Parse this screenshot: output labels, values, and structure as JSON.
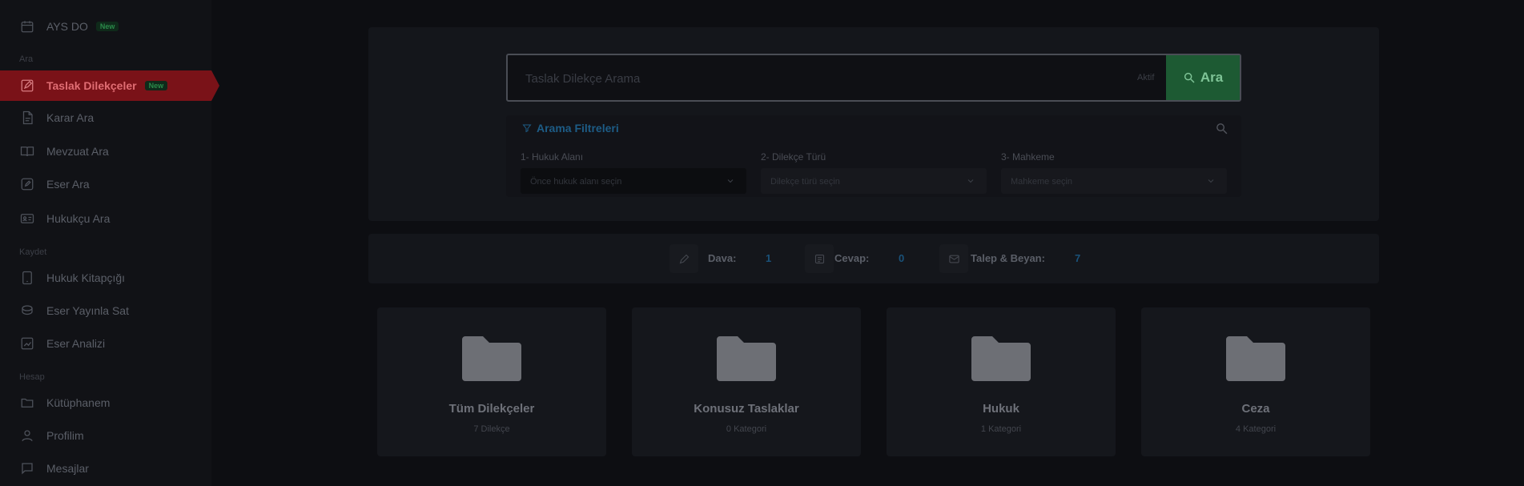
{
  "sidebar": {
    "top_item": {
      "label": "AYS DO",
      "badge": "New",
      "icon": "calendar-icon"
    },
    "sections": [
      "Ara",
      "Kaydet",
      "Hesap"
    ],
    "items": [
      {
        "label": "Taslak Dilekçeler",
        "badge": "New",
        "icon": "edit-icon",
        "active": true
      },
      {
        "label": "Karar Ara",
        "icon": "document-icon"
      },
      {
        "label": "Mevzuat Ara",
        "icon": "book-open-icon"
      },
      {
        "label": "Eser Ara",
        "icon": "edit-square-icon"
      },
      {
        "label": "Hukukçu Ara",
        "icon": "id-card-icon"
      },
      {
        "label": "Hukuk Kitapçığı",
        "icon": "tablet-icon"
      },
      {
        "label": "Eser Yayınla Sat",
        "icon": "coin-icon"
      },
      {
        "label": "Eser Analizi",
        "icon": "chart-icon"
      },
      {
        "label": "Kütüphanem",
        "icon": "folder-icon"
      },
      {
        "label": "Profilim",
        "icon": "user-icon"
      },
      {
        "label": "Mesajlar",
        "icon": "message-icon"
      }
    ]
  },
  "search": {
    "placeholder": "Taslak Dilekçe Arama",
    "status": "Aktif",
    "button_label": "Ara"
  },
  "filters": {
    "title": "Arama Filtreleri",
    "fields": [
      {
        "label": "1- Hukuk Alanı",
        "value": "Önce hukuk alanı seçin"
      },
      {
        "label": "2- Dilekçe Türü",
        "value": "Dilekçe türü seçin"
      },
      {
        "label": "3- Mahkeme",
        "value": "Mahkeme seçin"
      }
    ]
  },
  "stats": [
    {
      "label": "Dava:",
      "value": "1",
      "icon": "edit-icon"
    },
    {
      "label": "Cevap:",
      "value": "0",
      "icon": "list-icon"
    },
    {
      "label": "Talep & Beyan:",
      "value": "7",
      "icon": "mail-icon"
    }
  ],
  "cards": [
    {
      "title": "Tüm Dilekçeler",
      "subtitle": "7 Dilekçe"
    },
    {
      "title": "Konusuz Taslaklar",
      "subtitle": "0 Kategori"
    },
    {
      "title": "Hukuk",
      "subtitle": "1 Kategori"
    },
    {
      "title": "Ceza",
      "subtitle": "4 Kategori"
    }
  ],
  "colors": {
    "active_red": "#7a1218",
    "search_green": "#1d5a33",
    "accent_blue": "#1d5c86"
  }
}
